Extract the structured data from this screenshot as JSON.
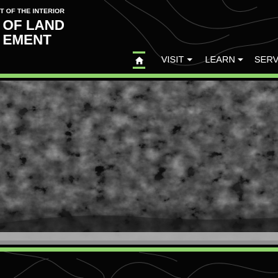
{
  "header": {
    "department": "T OF THE INTERIOR",
    "bureau_line1": "OF LAND",
    "bureau_line2": "EMENT"
  },
  "nav": {
    "home_icon": "home-icon",
    "items": [
      {
        "label": "VISIT"
      },
      {
        "label": "LEARN"
      },
      {
        "label": "SERVI"
      }
    ]
  },
  "hero": {
    "image": "rock-cliff-photo"
  },
  "colors": {
    "accent": "#8ed36b",
    "background": "#050505",
    "text": "#ffffff"
  }
}
